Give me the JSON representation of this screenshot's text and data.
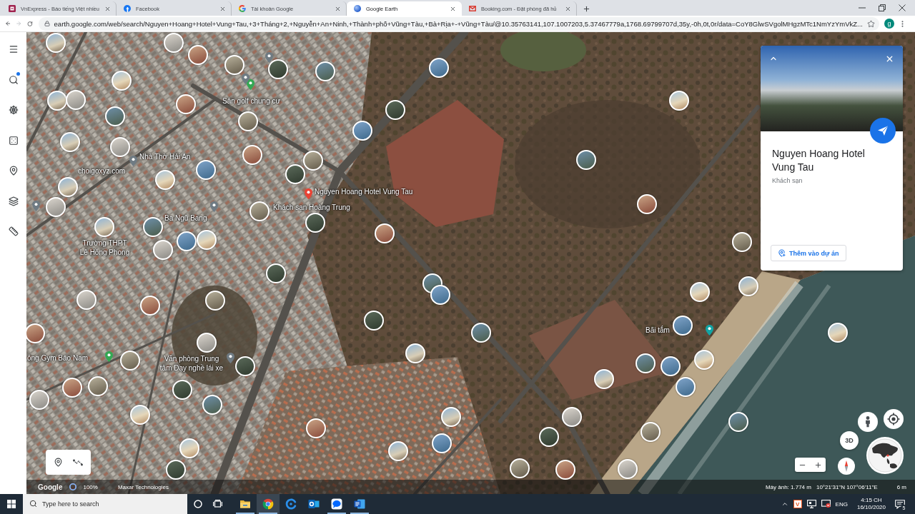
{
  "browser": {
    "tabs": [
      {
        "kind": "news",
        "title": "VnExpress - Báo tiếng Việt nhiều",
        "selected": false
      },
      {
        "kind": "social",
        "title": "Facebook",
        "selected": false
      },
      {
        "kind": "account",
        "title": "Tài khoản Google",
        "selected": false
      },
      {
        "kind": "earth",
        "title": "Google Earth",
        "selected": true
      },
      {
        "kind": "mail",
        "title": "Booking.com - Đặt phòng đã hủ",
        "selected": false
      }
    ],
    "navigation": {
      "back_disabled": false,
      "forward_disabled": true
    },
    "address_bar": {
      "url": "earth.google.com/web/search/Nguyen+Hoang+Hotel+Vung+Tau,+3+Tháng+2,+Nguyễn+An+Ninh,+Thành+phố+Vũng+Tàu,+Bà+Rịa+-+Vũng+Tàu/@10.35763141,107.1007203,5.37467779a,1768.69799707d,35y,-0h,0t,0r/data=CoY8GlwSVgolMHgzMTc1NmYzYmVkZ..."
    },
    "profile": {
      "initial": "g"
    }
  },
  "earth": {
    "map": {
      "labels": [
        {
          "text": "Sân golf chung cư"
        },
        {
          "text": "Nhà Thờ Hải An"
        },
        {
          "text": "choigoxyz.com"
        },
        {
          "text": "Nguyen Hoang Hotel Vung Tau"
        },
        {
          "text": "Khách sạn Hoàng Trung"
        },
        {
          "text": "Ba Ngũ Bang"
        },
        {
          "text": "Trường THPT Lê Hồng Phong"
        },
        {
          "text": "Bãi tắm"
        },
        {
          "text": "ông Gym Bảo Nam"
        },
        {
          "text": "Văn phòng Trung tâm Dạy nghề lái xe"
        }
      ]
    },
    "place_card": {
      "title": "Nguyen Hoang Hotel Vung Tau",
      "category": "Khách sạn",
      "action": "Thêm vào dự án"
    },
    "view_mode": "3D",
    "status_bar": {
      "brand": "Google",
      "loading": {
        "level": 1,
        "reading": "100%"
      },
      "imagery_credit": "Maxar Technologies",
      "camera_altitude": "Máy ảnh: 1.774 m",
      "coordinates": "10°21'31\"N 107°06'11\"E",
      "scale": "6 m"
    }
  },
  "taskbar": {
    "search_placeholder": "Type here to search",
    "apps": [
      {
        "kind": "files",
        "running": true,
        "selected": false
      },
      {
        "kind": "chrome",
        "running": true,
        "selected": true
      },
      {
        "kind": "edge",
        "running": false,
        "selected": false
      },
      {
        "kind": "outlook",
        "running": false,
        "selected": false
      },
      {
        "kind": "zalo",
        "running": true,
        "selected": false
      },
      {
        "kind": "word",
        "running": true,
        "selected": false
      }
    ],
    "input_method": "V",
    "language": "ENG",
    "time": "4:15 CH",
    "date": "16/10/2020",
    "notification_count": "5"
  }
}
